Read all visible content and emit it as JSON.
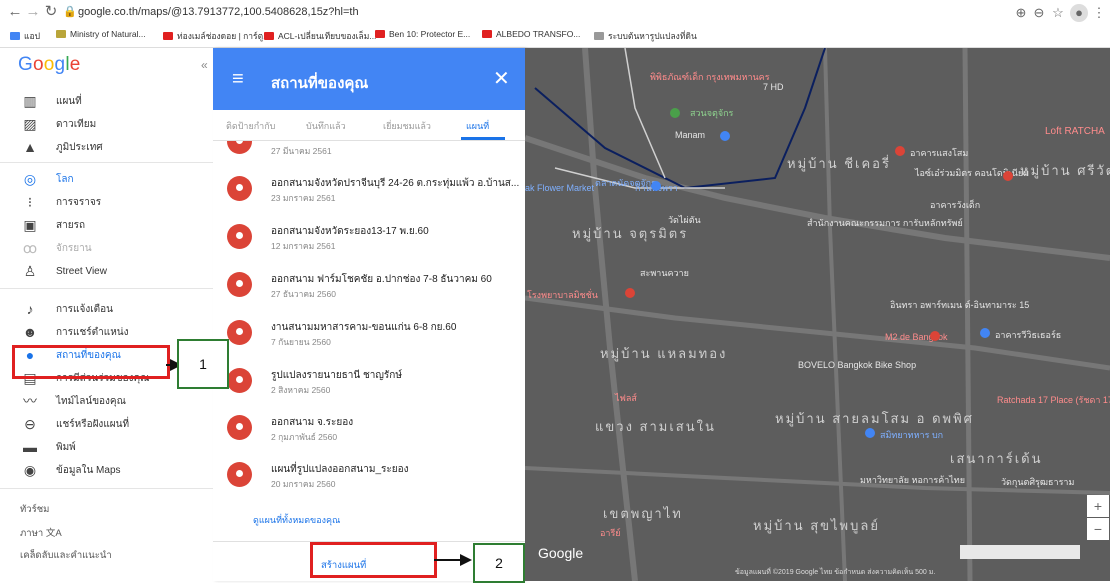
{
  "browser": {
    "url": "google.co.th/maps/@13.7913772,100.5408628,15z?hl=th",
    "bookmarks": [
      "แอป",
      "Ministry of Natural...",
      "ท่องเมล์ช่องดอย | การ์ตู...",
      "ACL-เปลี่ยนเทียบของเล็ม...",
      "Ben 10: Protector E...",
      "ALBEDO TRANSFO...",
      "ระบบต้นหารูปแปลงที่ดิน"
    ]
  },
  "sidebar": {
    "logo": "Google",
    "items": [
      {
        "label": "แผนที่",
        "icon": "map-icon"
      },
      {
        "label": "ดาวเทียม",
        "icon": "satellite-icon"
      },
      {
        "label": "ภูมิประเทศ",
        "icon": "terrain-icon"
      },
      {
        "label": "โลก",
        "icon": "globe-icon"
      },
      {
        "label": "การจราจร",
        "icon": "traffic-icon"
      },
      {
        "label": "สายรถ",
        "icon": "transit-icon"
      },
      {
        "label": "จักรยาน",
        "icon": "bicycle-icon"
      },
      {
        "label": "Street View",
        "icon": "pegman-icon"
      },
      {
        "label": "การแจ้งเตือน",
        "icon": "bell-icon"
      },
      {
        "label": "การแชร์ตำแหน่ง",
        "icon": "location-sharing-icon"
      },
      {
        "label": "สถานที่ของคุณ",
        "icon": "pin-icon"
      },
      {
        "label": "การมีส่วนร่วมของคุณ",
        "icon": "contributions-icon"
      },
      {
        "label": "ไทม์ไลน์ของคุณ",
        "icon": "timeline-icon"
      },
      {
        "label": "แชร์หรือฝังแผนที่",
        "icon": "link-icon"
      },
      {
        "label": "พิมพ์",
        "icon": "print-icon"
      },
      {
        "label": "ข้อมูลใน Maps",
        "icon": "data-icon"
      }
    ],
    "footer": [
      "ทัวร์ชม",
      "ภาษา 文A",
      "เคล็ดลับและคำแนะนำ"
    ]
  },
  "panel": {
    "title": "สถานที่ของคุณ",
    "tabs": [
      "ติดป้ายกำกับ",
      "บันทึกแล้ว",
      "เยี่ยมชมแล้ว",
      "แผนที่"
    ],
    "active_tab": "แผนที่",
    "places": [
      {
        "name": "",
        "date": "27 มีนาคม 2561"
      },
      {
        "name": "ออกสนามจังหวัดปราจีนบุรี 24-26 ต.กระทุ่มแพ้ว อ.บ้านส...",
        "date": "23 มกราคม 2561"
      },
      {
        "name": "ออกสนามจังหวัดระยอง13-17 พ.ย.60",
        "date": "12 มกราคม 2561"
      },
      {
        "name": "ออกสนาม ฟาร์มโชคชัย อ.ปากช่อง 7-8 ธันวาคม 60",
        "date": "27 ธันวาคม 2560"
      },
      {
        "name": "งานสนามมหาสารคาม-ขอนแก่น 6-8 กย.60",
        "date": "7 กันยายน 2560"
      },
      {
        "name": "รูปแปลงรายนายธานี ชาญรักษ์",
        "date": "2 สิงหาคม 2560"
      },
      {
        "name": "ออกสนาม จ.ระยอง",
        "date": "2 กุมภาพันธ์ 2560"
      },
      {
        "name": "แผนที่รูปแปลงออกสนาม_ระยอง",
        "date": "20 มกราคม 2560"
      }
    ],
    "see_all": "ดูแผนที่ทั้งหมดของคุณ",
    "create_map": "สร้างแผนที่"
  },
  "map": {
    "labels": [
      "พิพิธภัณฑ์เด็ก กรุงเทพมหานคร",
      "สวนจตุจักร",
      "7 HD",
      "Manam",
      "อาคารแสงโสม",
      "Loft RATCHA",
      "หมู่บ้าน ชีเคอรี่",
      "ตลาดนัดจตุจักร",
      "ไอซ์เอ๋ร่วมมิตร คอนโดมิเนียม",
      "หมู่บ้าน ศรีวัฒนา",
      "ak Flower Market",
      "ก้านพงพรา",
      "อาคารวังเด็ก",
      "วัดไผ่ตัน",
      "หมู่บ้าน จตุรมิตร",
      "สำนักงานคณะกรรมการ การับหลักทรัพย์",
      "สะพานควาย",
      "โรงพยาบาลมิชชั่น",
      "อินทรา อพาร์ทเมน ต์-อินทามาระ 15",
      "M2 de Bangkok",
      "อาคารวีวิธเธอร์ธ",
      "หมู่บ้าน แหลมทอง",
      "BOVELO Bangkok Bike Shop",
      "Ratchada 17 Place (รัชดา 17 เพลส)",
      "แขวง สามเสนใน",
      "หมู่บ้าน สายลมโสม อ ดพพิศ",
      "สมิทยาทหาร บก",
      "เสนาการ์เด้น",
      "หมู่บ้าน สุขไพบูลย์",
      "เขตพญาไท",
      "มหาวิทยาลัย หอการค้าไทย",
      "วัดกุนตศิรุฒธาราม",
      "ไฟลส์",
      "อารีย์"
    ],
    "logo": "Google",
    "footer": "ข้อมูลแผนที่ ©2019 Google   ไทย   ข้อกำหนด   ส่งความคิดเห็น   500 ม.",
    "zoom_in": "+",
    "zoom_out": "−"
  },
  "annotations": {
    "callout1": "1",
    "callout2": "2"
  },
  "colors": {
    "accent": "#4285f4",
    "pin": "#db4437",
    "annotation_red": "#e02020",
    "annotation_green": "#2e7d32"
  }
}
